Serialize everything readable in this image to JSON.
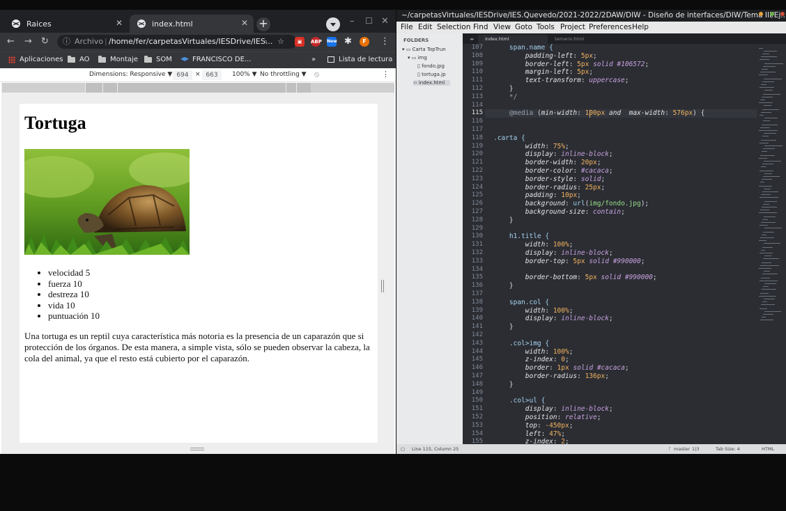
{
  "browser": {
    "tabs": [
      {
        "title": "Raices",
        "active": false
      },
      {
        "title": "index.html",
        "active": true
      }
    ],
    "new_tab": "+",
    "address": {
      "info": "ⓘ",
      "scheme_label": "Archivo",
      "separator": "|",
      "url": "/home/fer/carpetasVirtuales/IESDrive/IES..."
    },
    "extensions": [
      "ABP",
      "New",
      "F"
    ],
    "bookmarks": [
      "Aplicaciones",
      "AO",
      "Montaje",
      "SOM",
      "FRANCISCO DE..."
    ],
    "bookmarks_overflow": "»",
    "reading_list": "Lista de lectura",
    "devtools": {
      "dimensions": "Dimensions: Responsive ▼",
      "width": "694",
      "times": "×",
      "height": "663",
      "zoom": "100% ▼",
      "throttling": "No throttling ▼"
    },
    "page": {
      "title": "Tortuga",
      "list": [
        "velocidad 5",
        "fuerza 10",
        "destreza 10",
        "vida 10",
        "puntuación 10"
      ],
      "paragraph": "Una tortuga es un reptil cuya característica más notoria es la presencia de un caparazón que si protección de los órganos. De esta manera, a simple vista, sólo se pueden observar la cabeza, la cola del animal, ya que el resto está cubierto por el caparazón."
    }
  },
  "editor": {
    "title": "~/carpetasVirtuales/IESDrive/IES.Quevedo/2021-2022/2DAW/DIW - Diseño de interfaces/DIW/Tema III/Ej...",
    "menu": [
      "File",
      "Edit",
      "Selection",
      "Find",
      "View",
      "Goto",
      "Tools",
      "Project",
      "Preferences",
      "Help"
    ],
    "sidebar": {
      "header": "FOLDERS",
      "items": [
        "Carta TopTrun",
        "img",
        "fondo.jpg",
        "tortuga.jp",
        "index.html"
      ]
    },
    "tabs": [
      "index.html",
      "temario.html"
    ],
    "line_numbers": [
      "107",
      "108",
      "109",
      "110",
      "111",
      "112",
      "113",
      "114",
      "115",
      "116",
      "117",
      "118",
      "119",
      "120",
      "121",
      "122",
      "123",
      "124",
      "125",
      "126",
      "127",
      "128",
      "129",
      "130",
      "131",
      "132",
      "133",
      "134",
      "135",
      "136",
      "137",
      "138",
      "139",
      "140",
      "141",
      "142",
      "143",
      "144",
      "145",
      "146",
      "147",
      "148",
      "149",
      "150",
      "151",
      "152",
      "153",
      "154",
      "155"
    ],
    "code_lines": [
      "    span.name {",
      "        padding-left: 5px;",
      "        border-left: 5px solid #106572;",
      "        margin-left: 5px;",
      "        text-transform: uppercase;",
      "    }",
      "    */",
      "",
      "    @media (min-width: 100px and  max-width: 576px) {",
      "",
      "",
      ".carta {",
      "        width: 75%;",
      "        display: inline-block;",
      "        border-width: 20px;",
      "        border-color: #cacaca;",
      "        border-style: solid;",
      "        border-radius: 25px;",
      "        padding: 10px;",
      "        background: url(img/fondo.jpg);",
      "        background-size: contain;",
      "    }",
      "",
      "    h1.title {",
      "        width: 100%;",
      "        display: inline-block;",
      "        border-top: 5px solid #990000;",
      "",
      "        border-bottom: 5px solid #990000;",
      "    }",
      "",
      "    span.col {",
      "        width: 100%;",
      "        display: inline-block;",
      "    }",
      "",
      "    .col>img {",
      "        width: 100%;",
      "        z-index: 0;",
      "        border: 1px solid #cacaca;",
      "        border-radius: 136px;",
      "    }",
      "",
      "    .col>ul {",
      "        display: inline-block;",
      "        position: relative;",
      "        top: -450px;",
      "        left: 47%;",
      "        z-index: 2;"
    ],
    "status": {
      "position": "Line 115, Column 25",
      "branch": "master",
      "branch_info": "1|3",
      "tab_size": "Tab Size: 4",
      "syntax": "HTML"
    }
  },
  "colors": {
    "chrome_dark": "#202124",
    "chrome_toolbar": "#35363a",
    "editor_bg": "#2b2d33",
    "keyword": "#98d0e8",
    "number": "#f4b35e",
    "string": "#9adf86"
  }
}
